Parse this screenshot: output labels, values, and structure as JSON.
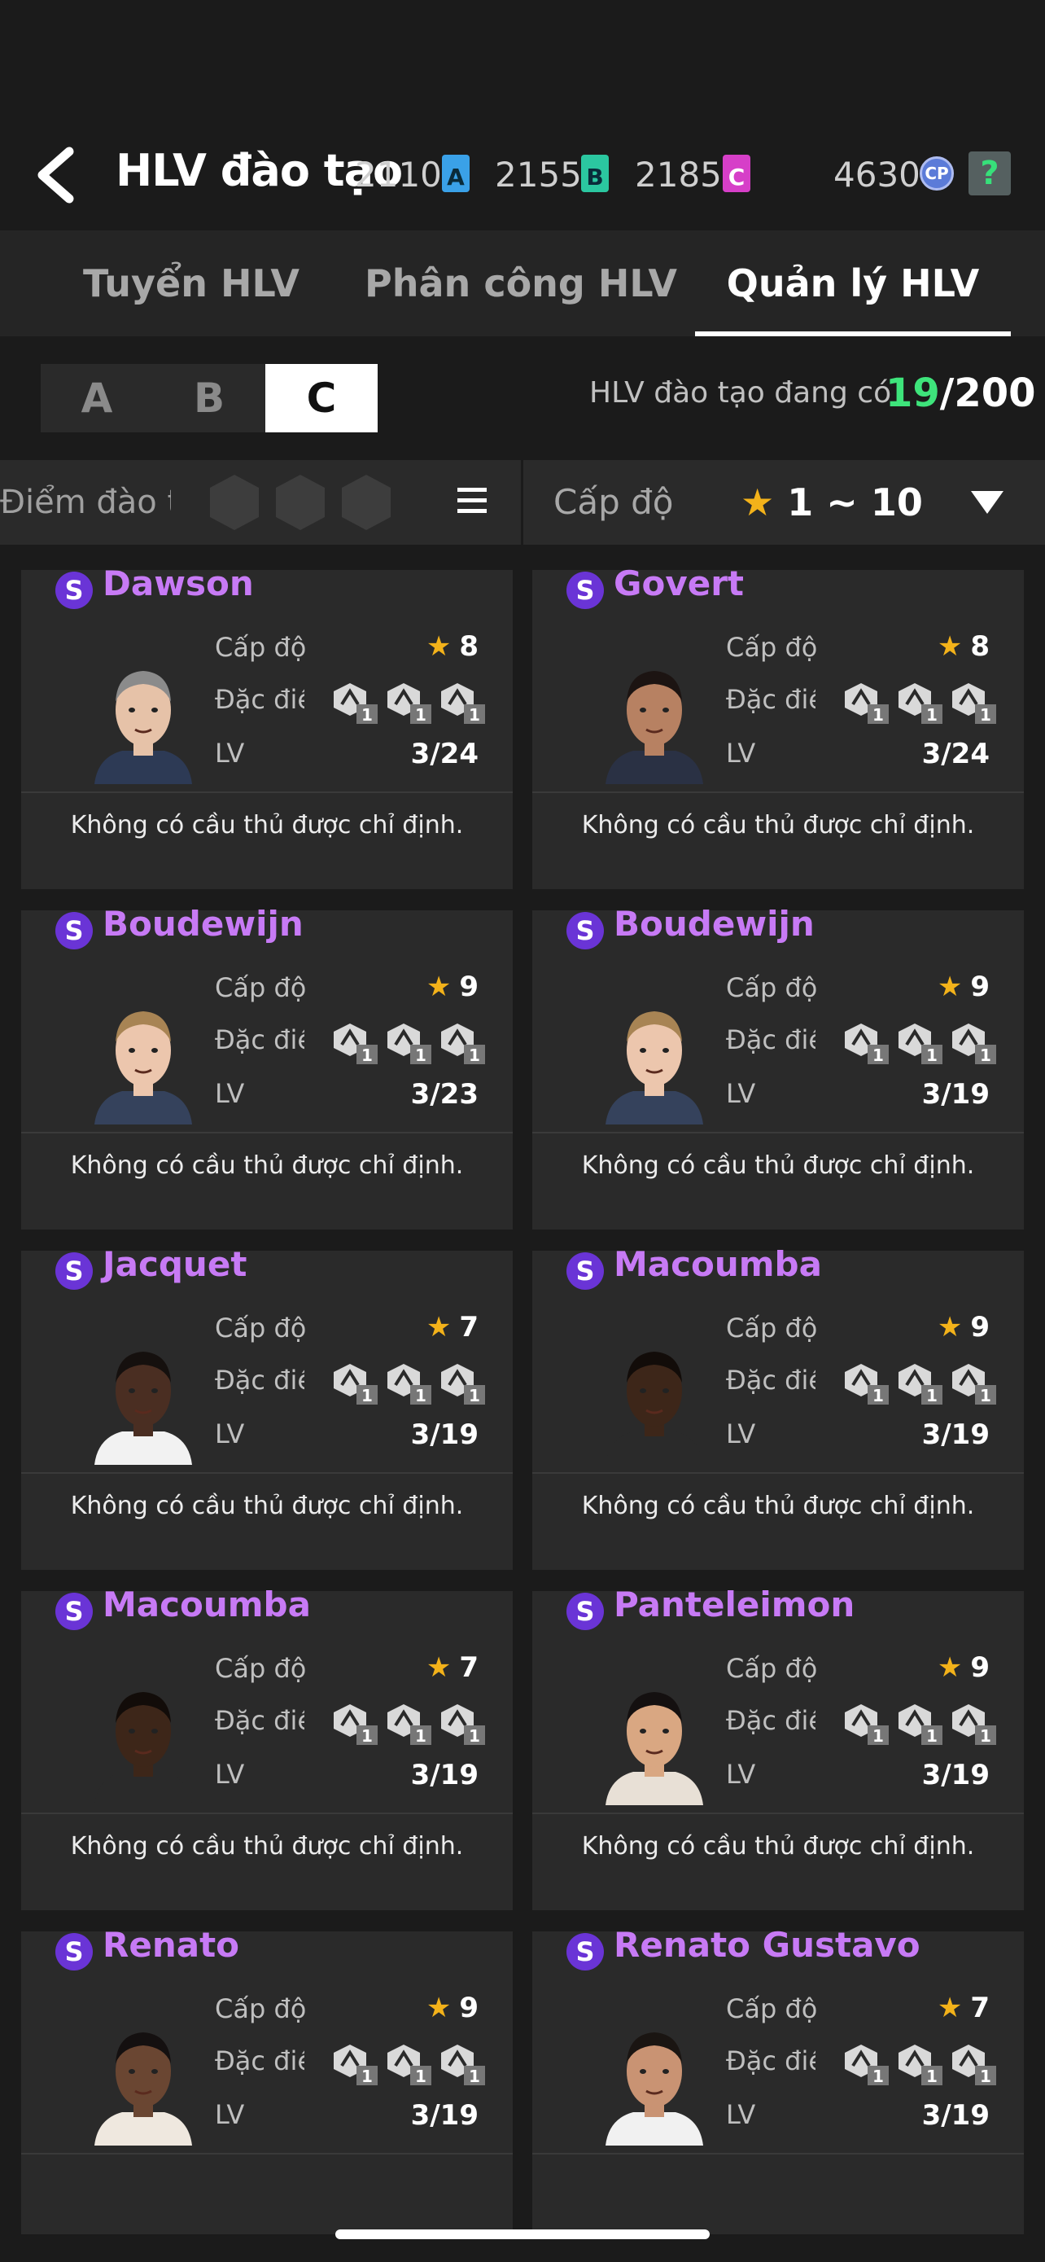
{
  "header": {
    "title": "HLV đào tạo",
    "currencies": [
      {
        "amount": "2110",
        "letter": "A",
        "color": "#3aa1e8"
      },
      {
        "amount": "2155",
        "letter": "B",
        "color": "#2bc7a0"
      },
      {
        "amount": "2185",
        "letter": "C",
        "color": "#d63fc8"
      }
    ],
    "cp_amount": "4630",
    "cp_label": "CP",
    "help_label": "?"
  },
  "tabs": [
    {
      "label": "Tuyển HLV"
    },
    {
      "label": "Phân công HLV"
    },
    {
      "label": "Quản lý HLV",
      "active": true
    }
  ],
  "grade_filter": {
    "options": [
      "A",
      "B",
      "C"
    ],
    "selected": "C"
  },
  "owned": {
    "label": "HLV đào tạo đang có",
    "count": "19",
    "total": "/200"
  },
  "filter_bar": {
    "trait_label": "Điểm đào tạo",
    "level_label": "Cấp độ",
    "level_star": "★",
    "level_range": "1 ~ 10"
  },
  "labels": {
    "level": "Cấp độ",
    "traits": "Đặc điểm",
    "lv": "LV",
    "star": "★",
    "grade": "S"
  },
  "coaches": [
    {
      "name": "Dawson",
      "level": "8",
      "lv": "3/24",
      "note": "Không có cầu thủ được chỉ định.",
      "skin": "#e6c2a8",
      "hair": "#8b8b8b",
      "shirt": "#2d3a55",
      "trait_counts": [
        "1",
        "1",
        "1"
      ]
    },
    {
      "name": "Govert",
      "level": "8",
      "lv": "3/24",
      "note": "Không có cầu thủ được chỉ định.",
      "skin": "#b78162",
      "hair": "#1c1412",
      "shirt": "#2a3144",
      "trait_counts": [
        "1",
        "1",
        "1"
      ]
    },
    {
      "name": "Boudewijn",
      "level": "9",
      "lv": "3/23",
      "note": "Không có cầu thủ được chỉ định.",
      "skin": "#ecc6ad",
      "hair": "#a88454",
      "shirt": "#35425c",
      "trait_counts": [
        "1",
        "1",
        "1"
      ]
    },
    {
      "name": "Boudewijn",
      "level": "9",
      "lv": "3/19",
      "note": "Không có cầu thủ được chỉ định.",
      "skin": "#ecc6ad",
      "hair": "#a88454",
      "shirt": "#35425c",
      "trait_counts": [
        "1",
        "1",
        "1"
      ]
    },
    {
      "name": "Jacquet",
      "level": "7",
      "lv": "3/19",
      "note": "Không có cầu thủ được chỉ định.",
      "skin": "#4a2e22",
      "hair": "#15100e",
      "shirt": "#f2f2f2",
      "trait_counts": [
        "1",
        "1",
        "1"
      ]
    },
    {
      "name": "Macoumba",
      "level": "9",
      "lv": "3/19",
      "note": "Không có cầu thủ được chỉ định.",
      "skin": "#3d2619",
      "hair": "#120c09",
      "shirt": "#2a2a2a",
      "trait_counts": [
        "1",
        "1",
        "1"
      ]
    },
    {
      "name": "Macoumba",
      "level": "7",
      "lv": "3/19",
      "note": "Không có cầu thủ được chỉ định.",
      "skin": "#3d2619",
      "hair": "#120c09",
      "shirt": "#2a2a2a",
      "trait_counts": [
        "1",
        "1",
        "1"
      ]
    },
    {
      "name": "Panteleimon",
      "level": "9",
      "lv": "3/19",
      "note": "Không có cầu thủ được chỉ định.",
      "skin": "#d9a782",
      "hair": "#141010",
      "shirt": "#e8e0d6",
      "trait_counts": [
        "1",
        "1",
        "1"
      ]
    },
    {
      "name": "Renato",
      "level": "9",
      "lv": "3/19",
      "note": "",
      "skin": "#6a4632",
      "hair": "#141010",
      "shirt": "#efe8df",
      "trait_counts": [
        "1",
        "1",
        "1"
      ]
    },
    {
      "name": "Renato Gustavo",
      "level": "7",
      "lv": "3/19",
      "note": "",
      "skin": "#c99373",
      "hair": "#1a1512",
      "shirt": "#f1f1f1",
      "trait_counts": [
        "1",
        "1",
        "1"
      ]
    }
  ],
  "colors": {
    "accent_purple": "#c77af5",
    "owned_green": "#3ee47b",
    "star": "#f3b21a",
    "background": "#1b1b1b",
    "card": "#2a2a2a"
  }
}
